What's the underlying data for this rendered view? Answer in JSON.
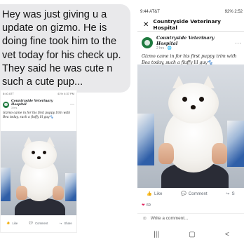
{
  "message": {
    "text": "Hey was just giving  u  a update on gizmo. He is doing fine took him to the vet today for his check up. They said he was cute n such a cute pup..."
  },
  "small_post": {
    "status_time": "8:40 ATT",
    "status_right": "41% 4:37 PM",
    "page_name": "Countryside Veterinary Hospital",
    "meta": "3 hrs",
    "caption": "Gizmo came in for his first puppy trim with Bea today, such a fluffy lil guy🐾",
    "like": "Like",
    "comment": "Comment",
    "share": "Share"
  },
  "large_post": {
    "status_time": "9:44 AT&T",
    "status_right": "92% 2:52",
    "title": "Countryside Veterinary Hospital",
    "page_name": "Countryside Veterinary Hospital",
    "meta": "2 hrs · 🌐",
    "caption": "Gizmo came in for his first puppy trim with Bea today, such a fluffy lil guy🐾",
    "like": "Like",
    "comment": "Comment",
    "share": "S",
    "reactions": "69",
    "write_comment": "Write a comment..."
  },
  "colors": {
    "bubble": "#e9e9eb",
    "brand_green": "#1f7a3f"
  }
}
